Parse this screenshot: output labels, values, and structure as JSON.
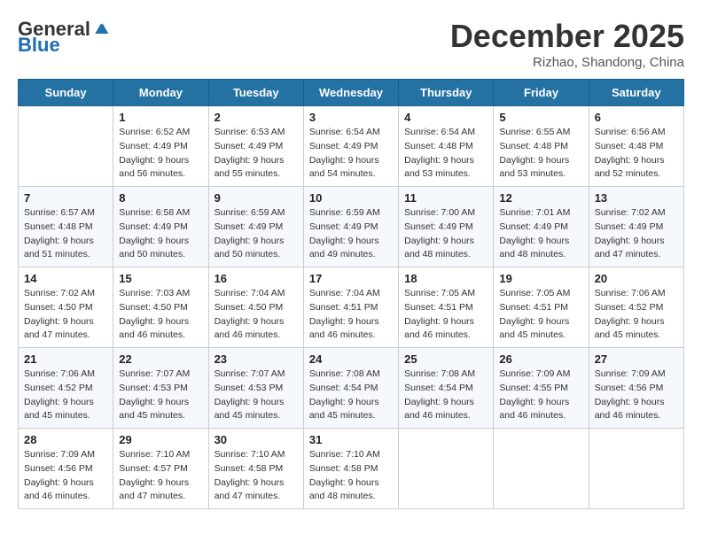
{
  "logo": {
    "general": "General",
    "blue": "Blue"
  },
  "header": {
    "month": "December 2025",
    "location": "Rizhao, Shandong, China"
  },
  "weekdays": [
    "Sunday",
    "Monday",
    "Tuesday",
    "Wednesday",
    "Thursday",
    "Friday",
    "Saturday"
  ],
  "weeks": [
    [
      {
        "day": "",
        "sunrise": "",
        "sunset": "",
        "daylight": ""
      },
      {
        "day": "1",
        "sunrise": "Sunrise: 6:52 AM",
        "sunset": "Sunset: 4:49 PM",
        "daylight": "Daylight: 9 hours and 56 minutes."
      },
      {
        "day": "2",
        "sunrise": "Sunrise: 6:53 AM",
        "sunset": "Sunset: 4:49 PM",
        "daylight": "Daylight: 9 hours and 55 minutes."
      },
      {
        "day": "3",
        "sunrise": "Sunrise: 6:54 AM",
        "sunset": "Sunset: 4:49 PM",
        "daylight": "Daylight: 9 hours and 54 minutes."
      },
      {
        "day": "4",
        "sunrise": "Sunrise: 6:54 AM",
        "sunset": "Sunset: 4:48 PM",
        "daylight": "Daylight: 9 hours and 53 minutes."
      },
      {
        "day": "5",
        "sunrise": "Sunrise: 6:55 AM",
        "sunset": "Sunset: 4:48 PM",
        "daylight": "Daylight: 9 hours and 53 minutes."
      },
      {
        "day": "6",
        "sunrise": "Sunrise: 6:56 AM",
        "sunset": "Sunset: 4:48 PM",
        "daylight": "Daylight: 9 hours and 52 minutes."
      }
    ],
    [
      {
        "day": "7",
        "sunrise": "Sunrise: 6:57 AM",
        "sunset": "Sunset: 4:48 PM",
        "daylight": "Daylight: 9 hours and 51 minutes."
      },
      {
        "day": "8",
        "sunrise": "Sunrise: 6:58 AM",
        "sunset": "Sunset: 4:49 PM",
        "daylight": "Daylight: 9 hours and 50 minutes."
      },
      {
        "day": "9",
        "sunrise": "Sunrise: 6:59 AM",
        "sunset": "Sunset: 4:49 PM",
        "daylight": "Daylight: 9 hours and 50 minutes."
      },
      {
        "day": "10",
        "sunrise": "Sunrise: 6:59 AM",
        "sunset": "Sunset: 4:49 PM",
        "daylight": "Daylight: 9 hours and 49 minutes."
      },
      {
        "day": "11",
        "sunrise": "Sunrise: 7:00 AM",
        "sunset": "Sunset: 4:49 PM",
        "daylight": "Daylight: 9 hours and 48 minutes."
      },
      {
        "day": "12",
        "sunrise": "Sunrise: 7:01 AM",
        "sunset": "Sunset: 4:49 PM",
        "daylight": "Daylight: 9 hours and 48 minutes."
      },
      {
        "day": "13",
        "sunrise": "Sunrise: 7:02 AM",
        "sunset": "Sunset: 4:49 PM",
        "daylight": "Daylight: 9 hours and 47 minutes."
      }
    ],
    [
      {
        "day": "14",
        "sunrise": "Sunrise: 7:02 AM",
        "sunset": "Sunset: 4:50 PM",
        "daylight": "Daylight: 9 hours and 47 minutes."
      },
      {
        "day": "15",
        "sunrise": "Sunrise: 7:03 AM",
        "sunset": "Sunset: 4:50 PM",
        "daylight": "Daylight: 9 hours and 46 minutes."
      },
      {
        "day": "16",
        "sunrise": "Sunrise: 7:04 AM",
        "sunset": "Sunset: 4:50 PM",
        "daylight": "Daylight: 9 hours and 46 minutes."
      },
      {
        "day": "17",
        "sunrise": "Sunrise: 7:04 AM",
        "sunset": "Sunset: 4:51 PM",
        "daylight": "Daylight: 9 hours and 46 minutes."
      },
      {
        "day": "18",
        "sunrise": "Sunrise: 7:05 AM",
        "sunset": "Sunset: 4:51 PM",
        "daylight": "Daylight: 9 hours and 46 minutes."
      },
      {
        "day": "19",
        "sunrise": "Sunrise: 7:05 AM",
        "sunset": "Sunset: 4:51 PM",
        "daylight": "Daylight: 9 hours and 45 minutes."
      },
      {
        "day": "20",
        "sunrise": "Sunrise: 7:06 AM",
        "sunset": "Sunset: 4:52 PM",
        "daylight": "Daylight: 9 hours and 45 minutes."
      }
    ],
    [
      {
        "day": "21",
        "sunrise": "Sunrise: 7:06 AM",
        "sunset": "Sunset: 4:52 PM",
        "daylight": "Daylight: 9 hours and 45 minutes."
      },
      {
        "day": "22",
        "sunrise": "Sunrise: 7:07 AM",
        "sunset": "Sunset: 4:53 PM",
        "daylight": "Daylight: 9 hours and 45 minutes."
      },
      {
        "day": "23",
        "sunrise": "Sunrise: 7:07 AM",
        "sunset": "Sunset: 4:53 PM",
        "daylight": "Daylight: 9 hours and 45 minutes."
      },
      {
        "day": "24",
        "sunrise": "Sunrise: 7:08 AM",
        "sunset": "Sunset: 4:54 PM",
        "daylight": "Daylight: 9 hours and 45 minutes."
      },
      {
        "day": "25",
        "sunrise": "Sunrise: 7:08 AM",
        "sunset": "Sunset: 4:54 PM",
        "daylight": "Daylight: 9 hours and 46 minutes."
      },
      {
        "day": "26",
        "sunrise": "Sunrise: 7:09 AM",
        "sunset": "Sunset: 4:55 PM",
        "daylight": "Daylight: 9 hours and 46 minutes."
      },
      {
        "day": "27",
        "sunrise": "Sunrise: 7:09 AM",
        "sunset": "Sunset: 4:56 PM",
        "daylight": "Daylight: 9 hours and 46 minutes."
      }
    ],
    [
      {
        "day": "28",
        "sunrise": "Sunrise: 7:09 AM",
        "sunset": "Sunset: 4:56 PM",
        "daylight": "Daylight: 9 hours and 46 minutes."
      },
      {
        "day": "29",
        "sunrise": "Sunrise: 7:10 AM",
        "sunset": "Sunset: 4:57 PM",
        "daylight": "Daylight: 9 hours and 47 minutes."
      },
      {
        "day": "30",
        "sunrise": "Sunrise: 7:10 AM",
        "sunset": "Sunset: 4:58 PM",
        "daylight": "Daylight: 9 hours and 47 minutes."
      },
      {
        "day": "31",
        "sunrise": "Sunrise: 7:10 AM",
        "sunset": "Sunset: 4:58 PM",
        "daylight": "Daylight: 9 hours and 48 minutes."
      },
      {
        "day": "",
        "sunrise": "",
        "sunset": "",
        "daylight": ""
      },
      {
        "day": "",
        "sunrise": "",
        "sunset": "",
        "daylight": ""
      },
      {
        "day": "",
        "sunrise": "",
        "sunset": "",
        "daylight": ""
      }
    ]
  ]
}
